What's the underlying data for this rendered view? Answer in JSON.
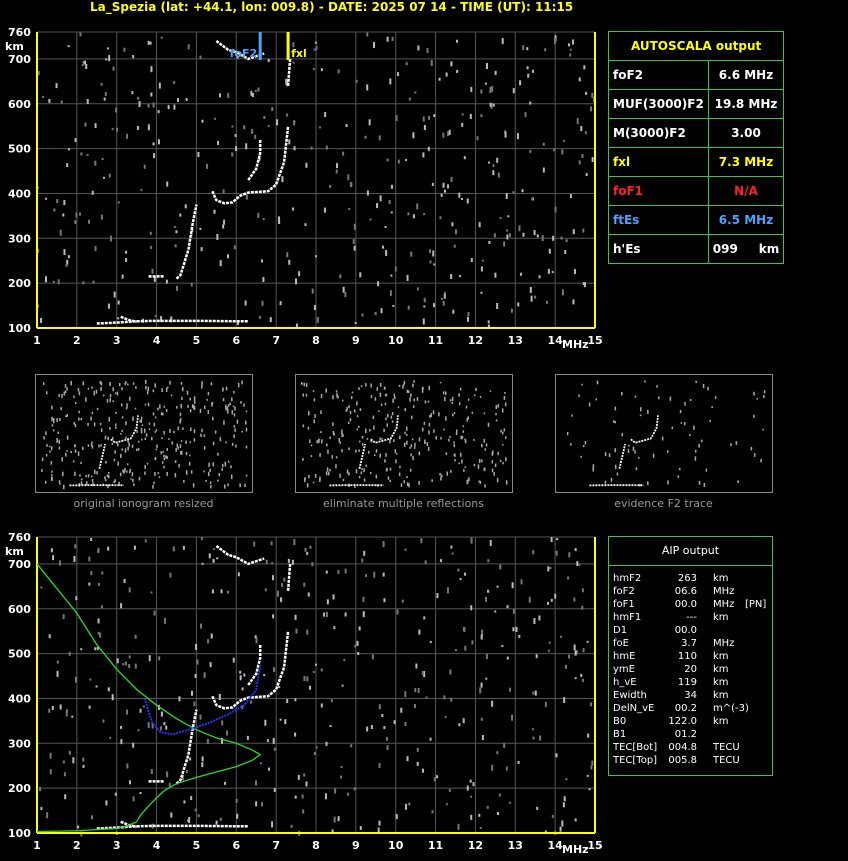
{
  "header": {
    "title": "La_Spezia (lat: +44.1, lon: 009.8) - DATE: 2025 07 14 - TIME (UT): 11:15"
  },
  "colors": {
    "axis": "#ffff00",
    "grid": "#555555",
    "trace": "#ffffff",
    "fof2_marker": "#4aa3ff",
    "fxl_marker": "#ffff00",
    "aip_profile": "#22dd22",
    "aip_fit": "#2233ff",
    "table_border": "#3fc33f"
  },
  "chart_data": [
    {
      "type": "scatter",
      "name": "top-ionogram",
      "x_ticks": [
        1,
        2,
        3,
        4,
        5,
        6,
        7,
        8,
        9,
        10,
        11,
        12,
        13,
        14,
        15
      ],
      "y_ticks": [
        100,
        200,
        300,
        400,
        500,
        600,
        700,
        760
      ],
      "xlim": [
        1,
        15
      ],
      "ylim": [
        100,
        760
      ],
      "xlabel": "MHz",
      "ylabel": "km",
      "grid": true,
      "markers": [
        {
          "label": "foF2",
          "x": 6.6,
          "color": "#4aa3ff"
        },
        {
          "label": "fxl",
          "x": 7.3,
          "color": "#ffff00"
        }
      ]
    },
    {
      "type": "scatter",
      "name": "bottom-ionogram",
      "x_ticks": [
        1,
        2,
        3,
        4,
        5,
        6,
        7,
        8,
        9,
        10,
        11,
        12,
        13,
        14,
        15
      ],
      "y_ticks": [
        100,
        200,
        300,
        400,
        500,
        600,
        700,
        760
      ],
      "xlim": [
        1,
        15
      ],
      "ylim": [
        100,
        760
      ],
      "xlabel": "MHz",
      "ylabel": "km",
      "grid": true,
      "profile_points": [
        [
          1,
          700
        ],
        [
          1.5,
          645
        ],
        [
          2,
          590
        ],
        [
          2.5,
          520
        ],
        [
          3,
          465
        ],
        [
          3.5,
          420
        ],
        [
          4,
          385
        ],
        [
          4.5,
          355
        ],
        [
          5,
          330
        ],
        [
          5.5,
          312
        ],
        [
          6,
          300
        ],
        [
          6.4,
          285
        ],
        [
          6.6,
          275
        ],
        [
          6.4,
          262
        ],
        [
          6,
          248
        ],
        [
          5.5,
          236
        ],
        [
          5,
          224
        ],
        [
          4.5,
          210
        ],
        [
          4.2,
          195
        ],
        [
          4,
          178
        ],
        [
          3.8,
          160
        ],
        [
          3.6,
          140
        ],
        [
          3.5,
          125
        ],
        [
          3.3,
          117
        ],
        [
          3,
          110
        ],
        [
          2,
          105
        ],
        [
          1,
          103
        ]
      ],
      "fit_points": [
        [
          3.7,
          400
        ],
        [
          3.8,
          370
        ],
        [
          3.9,
          345
        ],
        [
          4.1,
          325
        ],
        [
          4.4,
          320
        ],
        [
          4.8,
          330
        ],
        [
          5.3,
          345
        ],
        [
          5.8,
          365
        ],
        [
          6.2,
          385
        ],
        [
          6.5,
          420
        ],
        [
          6.6,
          475
        ]
      ]
    }
  ],
  "autoscala": {
    "title": "AUTOSCALA output",
    "rows": [
      {
        "label": "foF2",
        "value": "6.6 MHz",
        "label_color": "#ffffff",
        "value_color": "#ffffff"
      },
      {
        "label": "MUF(3000)F2",
        "value": "19.8 MHz",
        "label_color": "#ffffff",
        "value_color": "#ffffff"
      },
      {
        "label": "M(3000)F2",
        "value": "3.00",
        "label_color": "#ffffff",
        "value_color": "#ffffff"
      },
      {
        "label": "fxl",
        "value": "7.3 MHz",
        "label_color": "#ffff00",
        "value_color": "#ffff00"
      },
      {
        "label": "foF1",
        "value": "N/A",
        "label_color": "#ff2020",
        "value_color": "#ff2020"
      },
      {
        "label": "ftEs",
        "value": "6.5 MHz",
        "label_color": "#4aa3ff",
        "value_color": "#4aa3ff"
      },
      {
        "label": "h'Es",
        "value": "099     km",
        "label_color": "#ffffff",
        "value_color": "#ffffff"
      }
    ]
  },
  "thumbnails": [
    {
      "caption": "original ionogram resized"
    },
    {
      "caption": "eliminate multiple reflections"
    },
    {
      "caption": "evidence F2 trace"
    }
  ],
  "aip": {
    "title": "AIP output",
    "rows": [
      {
        "name": "hmF2",
        "value": "263",
        "unit": "km",
        "extra": ""
      },
      {
        "name": "foF2",
        "value": "06.6",
        "unit": "MHz",
        "extra": ""
      },
      {
        "name": "foF1",
        "value": "00.0",
        "unit": "MHz",
        "extra": "[PN]"
      },
      {
        "name": "hmF1",
        "value": "---",
        "unit": "km",
        "extra": ""
      },
      {
        "name": "D1",
        "value": "00.0",
        "unit": "",
        "extra": ""
      },
      {
        "name": "foE",
        "value": "3.7",
        "unit": "MHz",
        "extra": ""
      },
      {
        "name": "hmE",
        "value": "110",
        "unit": "km",
        "extra": ""
      },
      {
        "name": "ymE",
        "value": "20",
        "unit": "km",
        "extra": ""
      },
      {
        "name": "h_vE",
        "value": "119",
        "unit": "km",
        "extra": ""
      },
      {
        "name": "Ewidth",
        "value": "34",
        "unit": "km",
        "extra": ""
      },
      {
        "name": "DelN_vE",
        "value": "00.2",
        "unit": "m^(-3)",
        "extra": ""
      },
      {
        "name": "B0",
        "value": "122.0",
        "unit": "km",
        "extra": ""
      },
      {
        "name": "B1",
        "value": "01.2",
        "unit": "",
        "extra": ""
      },
      {
        "name": "TEC[Bot]",
        "value": "004.8",
        "unit": "TECU",
        "extra": ""
      },
      {
        "name": "TEC[Top]",
        "value": "005.8",
        "unit": "TECU",
        "extra": ""
      }
    ]
  }
}
